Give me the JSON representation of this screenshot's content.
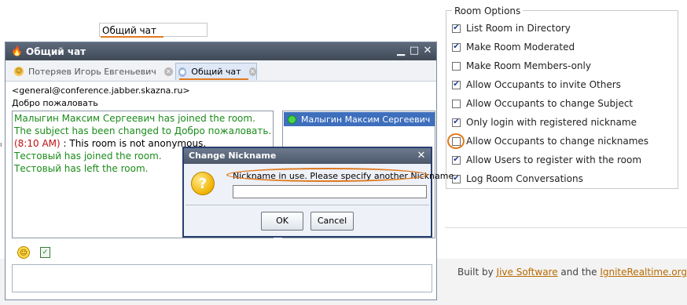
{
  "page": {
    "room_name_value": "Общий чат",
    "left_stub": "ı"
  },
  "room_options": {
    "legend": "Room Options",
    "items": [
      {
        "label": "List Room in Directory",
        "checked": true
      },
      {
        "label": "Make Room Moderated",
        "checked": true
      },
      {
        "label": "Make Room Members-only",
        "checked": false
      },
      {
        "label": "Allow Occupants to invite Others",
        "checked": true
      },
      {
        "label": "Allow Occupants to change Subject",
        "checked": false
      },
      {
        "label": "Only login with registered nickname",
        "checked": true
      },
      {
        "label": "Allow Occupants to change nicknames",
        "checked": false
      },
      {
        "label": "Allow Users to register with the room",
        "checked": true
      },
      {
        "label": "Log Room Conversations",
        "checked": true
      }
    ]
  },
  "chat_window": {
    "title": "Общий чат",
    "tabs": [
      {
        "label": "Потеряев Игорь Евгеньевич"
      },
      {
        "label": "Общий чат"
      }
    ],
    "room_jid": "<general@conference.jabber.skazna.ru>",
    "subject": "Добро пожаловать",
    "transcript": [
      {
        "text": "Малыгин Максим Сергеевич has joined the room."
      },
      {
        "text": "The subject has been changed to Добро пожаловать."
      },
      {
        "time": "(8:10 AM)",
        "text": " : This room is not anonymous."
      },
      {
        "text": "Тестовый has joined the room."
      },
      {
        "text": "Тестовый has left the room."
      }
    ],
    "occupants": [
      {
        "name": "Малыгин Максим Сергеевич"
      }
    ]
  },
  "dialog": {
    "title": "Change Nickname",
    "message": "Nickname in use. Please specify another Nickname",
    "input_value": "",
    "ok_label": "OK",
    "cancel_label": "Cancel"
  },
  "footer": {
    "prefix": "Built by ",
    "link1": "Jive Software",
    "middle": " and the ",
    "link2": "IgniteRealtime.org"
  },
  "colors": {
    "highlight": "#e07a1f",
    "join_message": "#1a8c1a",
    "timestamp": "#c01010",
    "selected_occupant": "#3e6fbd",
    "link": "#b86a00"
  },
  "icons": [
    "flame-icon",
    "minimize-icon",
    "maximize-icon",
    "close-icon",
    "user-status-icon",
    "groupchat-icon",
    "tab-close-icon",
    "occupant-online-icon",
    "smile-icon",
    "notes-icon",
    "question-icon"
  ]
}
